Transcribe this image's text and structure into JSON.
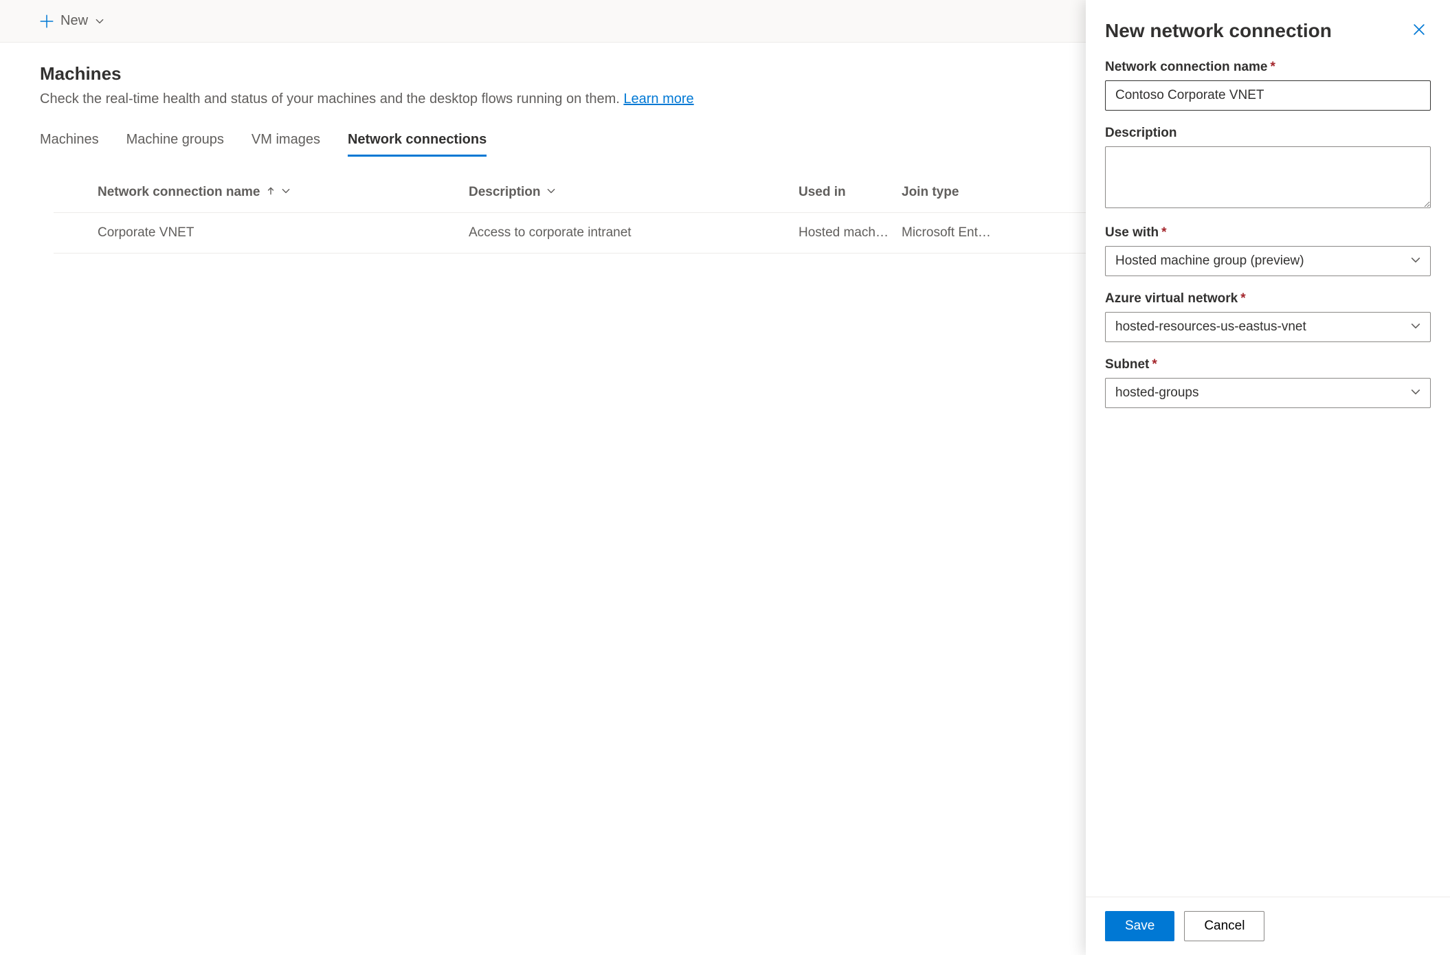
{
  "commandBar": {
    "newLabel": "New"
  },
  "page": {
    "title": "Machines",
    "subtitle_prefix": "Check the real-time health and status of your machines and the desktop flows running on them. ",
    "learnMore": "Learn more"
  },
  "tabs": [
    {
      "label": "Machines",
      "active": false
    },
    {
      "label": "Machine groups",
      "active": false
    },
    {
      "label": "VM images",
      "active": false
    },
    {
      "label": "Network connections",
      "active": true
    }
  ],
  "table": {
    "columns": {
      "name": "Network connection name",
      "description": "Description",
      "usedIn": "Used in",
      "joinType": "Join type"
    },
    "rows": [
      {
        "name": "Corporate VNET",
        "description": "Access to corporate intranet",
        "usedIn": "Hosted mach…",
        "joinType": "Microsoft Ent…"
      }
    ]
  },
  "panel": {
    "title": "New network connection",
    "fields": {
      "nameLabel": "Network connection name",
      "nameValue": "Contoso Corporate VNET",
      "descLabel": "Description",
      "descValue": "",
      "useWithLabel": "Use with",
      "useWithValue": "Hosted machine group (preview)",
      "avnLabel": "Azure virtual network",
      "avnValue": "hosted-resources-us-eastus-vnet",
      "subnetLabel": "Subnet",
      "subnetValue": "hosted-groups"
    },
    "saveLabel": "Save",
    "cancelLabel": "Cancel"
  }
}
